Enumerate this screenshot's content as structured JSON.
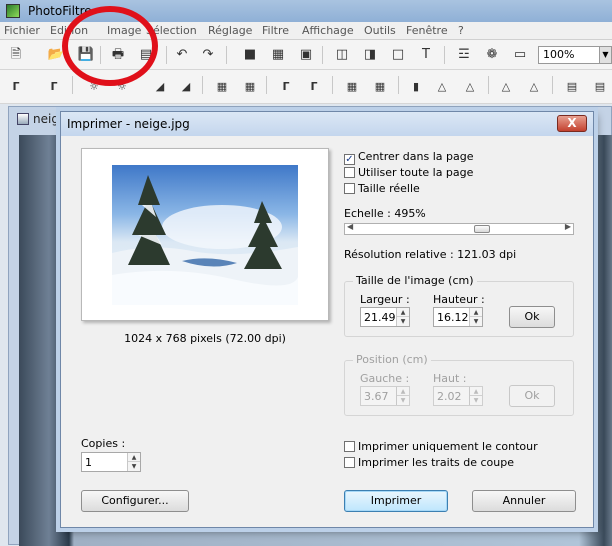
{
  "app": {
    "title": "PhotoFiltre",
    "menu": [
      "Fichier",
      "Edition",
      "Image",
      "Sélection",
      "Réglage",
      "Filtre",
      "Affichage",
      "Outils",
      "Fenêtre",
      "?"
    ],
    "zoom": "100%"
  },
  "document": {
    "title": "neige.jpg"
  },
  "dialog": {
    "title": "Imprimer - neige.jpg",
    "close_label": "X",
    "image_info": "1024 x 768 pixels (72.00 dpi)",
    "options": {
      "center_label": "Centrer dans la page",
      "center_checked": "✓",
      "fullpage_label": "Utiliser toute la page",
      "actual_label": "Taille réelle"
    },
    "scale_label": "Echelle : 495%",
    "scale_level_percent": 62,
    "resolution": "Résolution relative : 121.03 dpi",
    "size_group": {
      "title": "Taille de l'image (cm)",
      "width_label": "Largeur :",
      "height_label": "Hauteur :",
      "width_value": "21.49",
      "height_value": "16.12",
      "ok_label": "Ok"
    },
    "position_group": {
      "title": "Position (cm)",
      "left_label": "Gauche :",
      "top_label": "Haut :",
      "left_value": "3.67",
      "top_value": "2.02",
      "ok_label": "Ok"
    },
    "copies_label": "Copies :",
    "copies_value": "1",
    "print_outline_label": "Imprimer uniquement le contour",
    "print_cutmarks_label": "Imprimer les traits de coupe",
    "configure_label": "Configurer...",
    "print_label": "Imprimer",
    "cancel_label": "Annuler"
  },
  "colors": {
    "annotation_circle": "#e0101a",
    "dialog_border": "#6f87a8",
    "close_button": "#c3412f"
  }
}
